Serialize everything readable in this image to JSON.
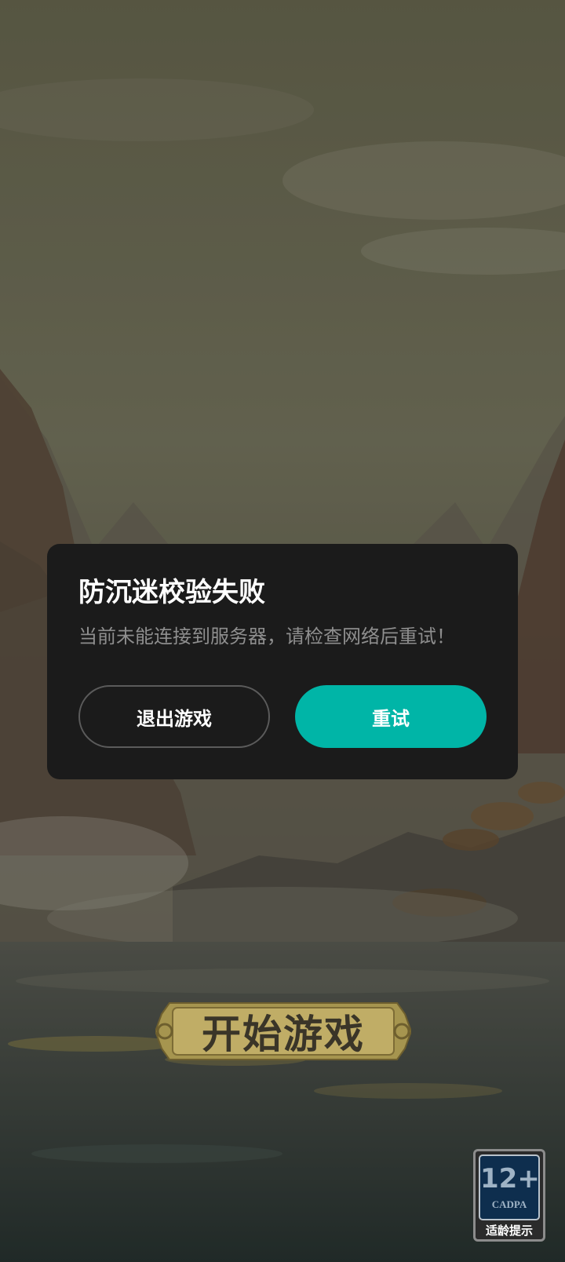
{
  "game": {
    "start_button_label": "开始游戏"
  },
  "age_rating": {
    "number": "12+",
    "org": "CADPA",
    "tip": "适龄提示"
  },
  "dialog": {
    "title": "防沉迷校验失败",
    "message": "当前未能连接到服务器，请检查网络后重试！",
    "exit_label": "退出游戏",
    "retry_label": "重试"
  },
  "colors": {
    "dialog_bg": "#1b1b1b",
    "retry_accent": "#00b5a7",
    "exit_border": "#5b5b5b",
    "start_button_gold": "#c8b26a"
  }
}
